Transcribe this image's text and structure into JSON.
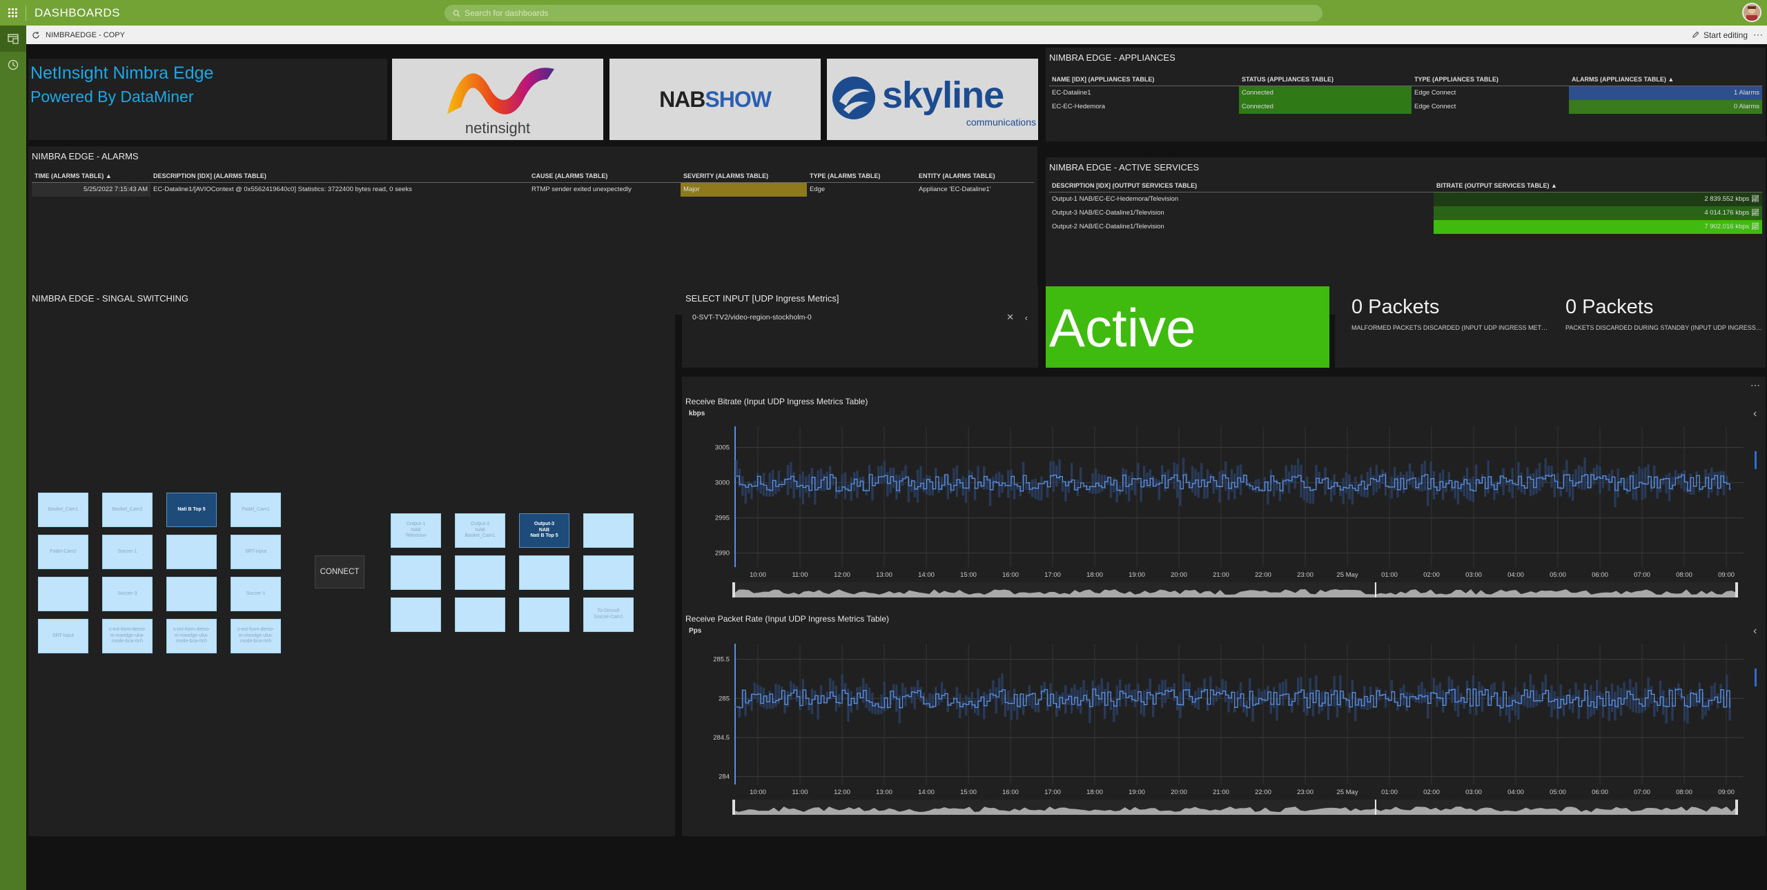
{
  "app": {
    "title": "DASHBOARDS",
    "search_placeholder": "Search for dashboards"
  },
  "sidebar": {
    "items": [
      {
        "icon": "dashboard-icon"
      },
      {
        "icon": "history-icon"
      }
    ]
  },
  "subbar": {
    "title": "NIMBRAEDGE - COPY",
    "edit_label": "Start editing",
    "more": "⋯"
  },
  "header": {
    "title": "NetInsight Nimbra Edge",
    "subtitle": "Powered By DataMiner"
  },
  "logos": {
    "netinsight": {
      "text": "netinsight"
    },
    "nabshow": {
      "text_a": "NAB",
      "text_b": "SHOW"
    },
    "skyline": {
      "text": "skyline",
      "sub": "communications"
    }
  },
  "appliances": {
    "title": "NIMBRA EDGE - APPLIANCES",
    "columns": [
      "NAME [IDX] (APPLIANCES TABLE)",
      "STATUS (APPLIANCES TABLE)",
      "TYPE (APPLIANCES TABLE)",
      "ALARMS (APPLIANCES TABLE)"
    ],
    "rows": [
      {
        "name": "EC-Dataline1",
        "status": "Connected",
        "type": "Edge Connect",
        "alarms": "1 Alarms",
        "alarm_color": "#2e4f8e"
      },
      {
        "name": "EC-EC-Hedemora",
        "status": "Connected",
        "type": "Edge Connect",
        "alarms": "0 Alarms",
        "alarm_color": "#3a7a1f"
      }
    ],
    "status_color": "#2f7a17"
  },
  "alarms": {
    "title": "NIMBRA EDGE - ALARMS",
    "columns": [
      "TIME (ALARMS TABLE)",
      "DESCRIPTION [IDX] (ALARMS TABLE)",
      "CAUSE (ALARMS TABLE)",
      "SEVERITY (ALARMS TABLE)",
      "TYPE (ALARMS TABLE)",
      "ENTITY (ALARMS TABLE)"
    ],
    "rows": [
      {
        "time": "5/25/2022 7:15:43 AM",
        "description": "EC-Dataline1/[AVIOContext @ 0x5562419640c0] Statistics: 3722400 bytes read, 0 seeks",
        "cause": "RTMP sender exited unexpectedly",
        "severity": "Major",
        "type": "Edge",
        "entity": "Appliance 'EC-Dataline1'"
      }
    ],
    "severity_color": "#8c7a1c"
  },
  "services": {
    "title": "NIMBRA EDGE - ACTIVE SERVICES",
    "columns": [
      "DESCRIPTION [IDX] (OUTPUT SERVICES TABLE)",
      "BITRATE (OUTPUT SERVICES TABLE)"
    ],
    "rows": [
      {
        "description": "Output-1 NAB/EC-EC-Hedemora/Television",
        "bitrate": "2 839.552 kbps",
        "color": "#1f3d14"
      },
      {
        "description": "Output-3 NAB/EC-Dataline1/Television",
        "bitrate": "4 014.176 kbps",
        "color": "#2a6416"
      },
      {
        "description": "Output-2 NAB/EC-Dataline1/Television",
        "bitrate": "7 902.016 kbps",
        "color": "#3fbb10"
      }
    ]
  },
  "switching": {
    "title": "NIMBRA EDGE - SINGAL SWITCHING",
    "connect_label": "CONNECT",
    "inputs": [
      {
        "l1": "Basket_Cam1",
        "l2": "",
        "l3": ""
      },
      {
        "l1": "Basket_Cam2",
        "l2": "",
        "l3": ""
      },
      {
        "l1": "Nati B Top 5",
        "l2": "",
        "l3": "",
        "selected": true
      },
      {
        "l1": "Padel_Cam1",
        "l2": "",
        "l3": ""
      },
      {
        "l1": "Padel-Cam2",
        "l2": "",
        "l3": ""
      },
      {
        "l1": "Soccer-1",
        "l2": "",
        "l3": ""
      },
      {
        "l1": "",
        "l2": "",
        "l3": ""
      },
      {
        "l1": "SRT-input",
        "l2": "",
        "l3": ""
      },
      {
        "l1": "",
        "l2": "",
        "l3": ""
      },
      {
        "l1": "Soccer-3",
        "l2": "",
        "l3": ""
      },
      {
        "l1": "",
        "l2": "",
        "l3": ""
      },
      {
        "l1": "Soccer-1",
        "l2": "",
        "l3": ""
      },
      {
        "l1": "SRT-input",
        "l2": "",
        "l3": ""
      },
      {
        "l1": "s-ext-from-demo-",
        "l2": "m-mxedge-ulra-",
        "l3": "mode-bca-rtch"
      },
      {
        "l1": "s-ext-from-demo-",
        "l2": "m-mxedge-ulra-",
        "l3": "mode-bca-rtch"
      },
      {
        "l1": "s-ext-from-demo-",
        "l2": "m-mxedge-ulra-",
        "l3": "mode-bca-rtch"
      }
    ],
    "outputs": [
      {
        "l1": "Output-1",
        "l2": "NAB",
        "l3": "Television"
      },
      {
        "l1": "Output-2",
        "l2": "NAB",
        "l3": "Basket_Cam1"
      },
      {
        "l1": "Output-3",
        "l2": "NAB",
        "l3": "Nati B Top 5",
        "selected": true
      },
      {
        "l1": "",
        "l2": "",
        "l3": ""
      },
      {
        "l1": "",
        "l2": "",
        "l3": ""
      },
      {
        "l1": "",
        "l2": "",
        "l3": ""
      },
      {
        "l1": "",
        "l2": "",
        "l3": ""
      },
      {
        "l1": "",
        "l2": "",
        "l3": ""
      },
      {
        "l1": "",
        "l2": "",
        "l3": ""
      },
      {
        "l1": "",
        "l2": "",
        "l3": ""
      },
      {
        "l1": "",
        "l2": "",
        "l3": ""
      },
      {
        "l1": "To-Demo5",
        "l2": "",
        "l3": "Soccer-Cam1"
      }
    ]
  },
  "select_input": {
    "title": "SELECT INPUT [UDP Ingress Metrics]",
    "value": "0-SVT-TV2/video-region-stockholm-0"
  },
  "status": {
    "label": "Active",
    "color": "#3fbb10"
  },
  "packets": [
    {
      "value": "0 Packets",
      "label": "MALFORMED PACKETS DISCARDED (INPUT UDP INGRESS METRI..."
    },
    {
      "value": "0 Packets",
      "label": "PACKETS DISCARDED DURING STANDBY (INPUT UDP INGRESS M..."
    }
  ],
  "charts_menu": "⋯",
  "chart_data": [
    {
      "type": "line",
      "title": "Receive Bitrate (Input UDP Ingress Metrics Table)",
      "ylabel": "kbps",
      "ylim": [
        2988,
        3008
      ],
      "yticks": [
        3005,
        3000,
        2995,
        2990
      ],
      "xticks": [
        "10:00",
        "11:00",
        "12:00",
        "13:00",
        "14:00",
        "15:00",
        "16:00",
        "17:00",
        "18:00",
        "19:00",
        "20:00",
        "21:00",
        "22:00",
        "23:00",
        "25 May",
        "01:00",
        "02:00",
        "03:00",
        "04:00",
        "05:00",
        "06:00",
        "07:00",
        "08:00",
        "09:00"
      ],
      "series": [
        {
          "mean": 3000,
          "spread": 1.2,
          "band": 2.5,
          "color": "#5b8fe0"
        }
      ]
    },
    {
      "type": "line",
      "title": "Receive Packet Rate (Input UDP Ingress Metrics Table)",
      "ylabel": "Pps",
      "ylim": [
        283.9,
        285.7
      ],
      "yticks": [
        285.5,
        285,
        284.5,
        284
      ],
      "xticks": [
        "10:00",
        "11:00",
        "12:00",
        "13:00",
        "14:00",
        "15:00",
        "16:00",
        "17:00",
        "18:00",
        "19:00",
        "20:00",
        "21:00",
        "22:00",
        "23:00",
        "25 May",
        "01:00",
        "02:00",
        "03:00",
        "04:00",
        "05:00",
        "06:00",
        "07:00",
        "08:00",
        "09:00"
      ],
      "series": [
        {
          "mean": 285,
          "spread": 0.12,
          "band": 0.22,
          "color": "#5b8fe0"
        }
      ]
    }
  ]
}
